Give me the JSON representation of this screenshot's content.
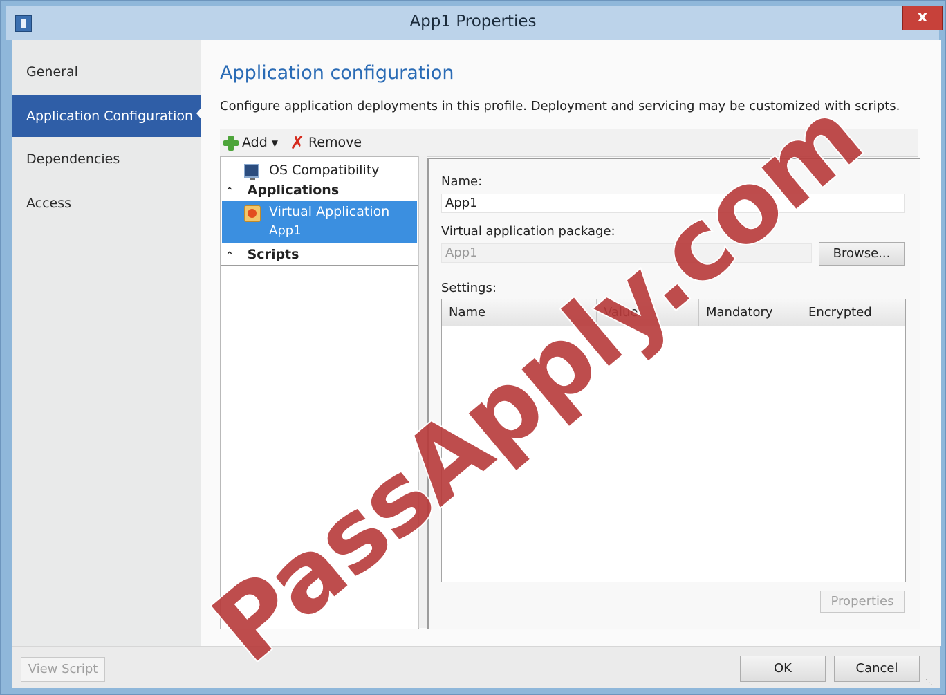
{
  "window": {
    "title": "App1 Properties",
    "close_label": "x"
  },
  "sidebar": {
    "items": [
      {
        "label": "General"
      },
      {
        "label": "Application Configuration",
        "active": true
      },
      {
        "label": "Dependencies"
      },
      {
        "label": "Access"
      }
    ]
  },
  "main": {
    "heading": "Application configuration",
    "description": "Configure application deployments in this profile. Deployment and servicing may be customized with scripts."
  },
  "toolbar": {
    "add_label": "Add",
    "remove_label": "Remove",
    "icons": {
      "add": "plus-icon",
      "remove": "x-icon",
      "add_menu": "caret-down-icon"
    }
  },
  "tree": {
    "os_compat": "OS Compatibility",
    "applications_header": "Applications",
    "selected_app": {
      "title": "Virtual Application",
      "subtitle": "App1"
    },
    "scripts_header": "Scripts"
  },
  "detail": {
    "name_label": "Name:",
    "name_value": "App1",
    "package_label": "Virtual application package:",
    "package_value": "App1",
    "browse_label": "Browse...",
    "settings_label": "Settings:",
    "columns": [
      "Name",
      "Value",
      "Mandatory",
      "Encrypted"
    ],
    "properties_label": "Properties"
  },
  "footer": {
    "view_script": "View Script",
    "ok": "OK",
    "cancel": "Cancel"
  },
  "watermark": "PassApply.com",
  "colors": {
    "accent": "#2f5ea7",
    "heading": "#2a6bb5",
    "selection": "#3b8fe0",
    "close": "#c7413a"
  }
}
